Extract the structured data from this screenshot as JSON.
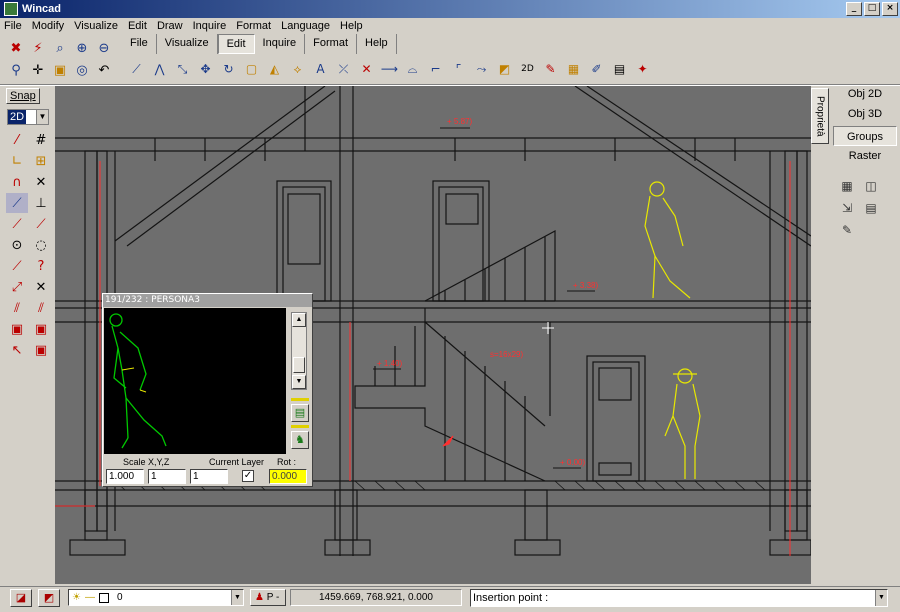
{
  "window": {
    "title": "Wincad",
    "controls": [
      "_",
      "□",
      "×"
    ]
  },
  "menu": [
    "File",
    "Modify",
    "Visualize",
    "Edit",
    "Draw",
    "Inquire",
    "Format",
    "Language",
    "Help"
  ],
  "tabs": [
    {
      "label": "File",
      "active": false
    },
    {
      "label": "Visualize",
      "active": false
    },
    {
      "label": "Edit",
      "active": true
    },
    {
      "label": "Inquire",
      "active": false
    },
    {
      "label": "Format",
      "active": false
    },
    {
      "label": "Help",
      "active": false
    }
  ],
  "left_toolbar": {
    "snap_label": "Snap",
    "mode_value": "2D"
  },
  "cmd_toolbar": {
    "text_tool_label": "2D"
  },
  "right_panel": {
    "vertical_tab": "Proprietà",
    "buttons": [
      {
        "label": "Obj 2D",
        "active": false
      },
      {
        "label": "Obj 3D",
        "active": false
      },
      {
        "label": "Groups",
        "active": true
      },
      {
        "label": "Raster",
        "active": false
      }
    ]
  },
  "drawing": {
    "annotations": [
      "+ 5.87)",
      "+ 3.38)",
      "+ 1.40)",
      "+ 0.00)",
      "+ 5.87)"
    ],
    "stair_label": "s=16x29)"
  },
  "preview": {
    "title": "191/232 : PERSONA3",
    "scale_label": "Scale X,Y,Z",
    "layer_label": "Current Layer",
    "rot_label": "Rot :",
    "scale_x": "1.000",
    "scale_y": "1",
    "scale_z": "1",
    "current_layer_checked": true,
    "rot_value": "0.000"
  },
  "status": {
    "layer_value": "0",
    "p_label": "P -",
    "coords": "1459.669, 768.921, 0.000",
    "command": "Insertion point :"
  },
  "colors": {
    "canvas_bg": "#6e6e6e",
    "line_dark": "#141414",
    "figure_yellow": "#e8e800",
    "figure_green": "#00c800",
    "accent_red": "#ff3030"
  }
}
